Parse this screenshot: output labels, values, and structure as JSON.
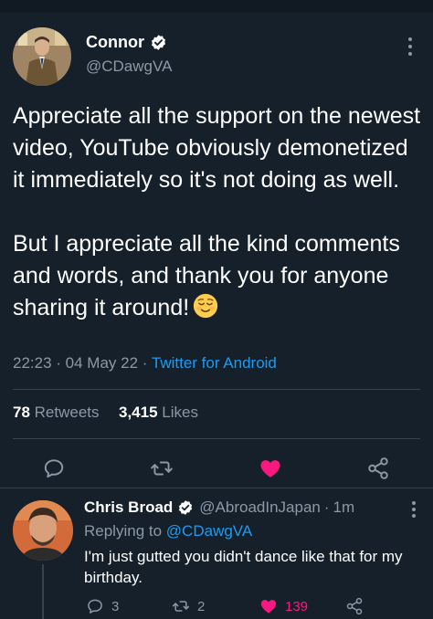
{
  "tweet": {
    "display_name": "Connor",
    "handle": "@CDawgVA",
    "text": "Appreciate all the support on the newest video, YouTube obviously demonetized it immediately so it's not doing as well.\n\nBut I appreciate all the kind comments and words, and thank you for anyone sharing it around!",
    "emoji": "relieved-face",
    "time": "22:23",
    "date": "04 May 22",
    "source": "Twitter for Android",
    "retweets_count": "78",
    "retweets_label": "Retweets",
    "likes_count": "3,415",
    "likes_label": "Likes"
  },
  "reply": {
    "display_name": "Chris Broad",
    "handle": "@AbroadInJapan",
    "time_ago": "1m",
    "replying_prefix": "Replying to",
    "replying_to": "@CDawgVA",
    "text": "I'm just gutted you didn't dance like that for my birthday.",
    "reply_count": "3",
    "retweet_count": "2",
    "like_count": "139"
  },
  "colors": {
    "background": "#15202b",
    "secondary_text": "#8b98a5",
    "link": "#1d9bf0",
    "like": "#f91880",
    "divider": "#38444d"
  }
}
